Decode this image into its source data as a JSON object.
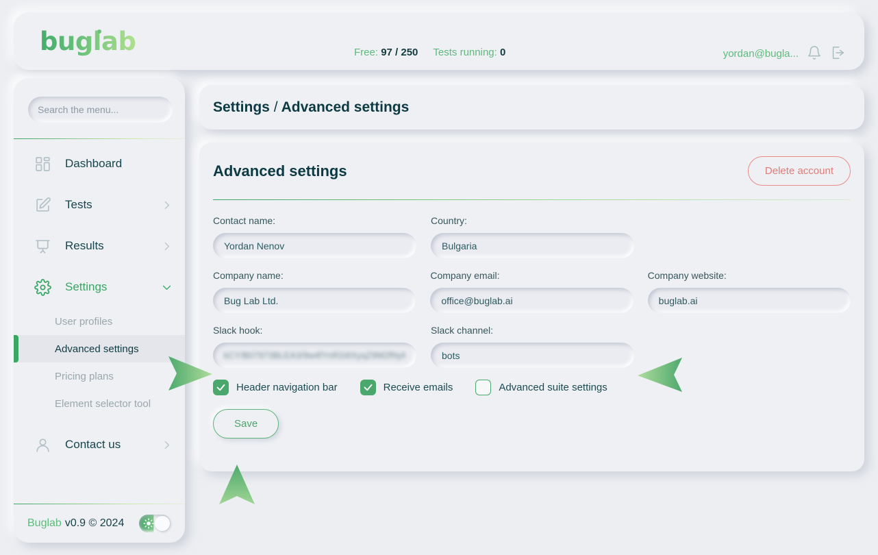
{
  "header": {
    "logo_text": "buglab",
    "free_label": "Free:",
    "free_value": "97 / 250",
    "tests_label": "Tests running:",
    "tests_value": "0",
    "user_email": "yordan@bugla...",
    "notification_icon": "bell-icon",
    "logout_icon": "logout-icon"
  },
  "sidebar": {
    "search": {
      "placeholder": "Search the menu...",
      "value": "",
      "clear_icon": "close-icon"
    },
    "items": [
      {
        "label": "Dashboard",
        "icon": "dashboard-grid-icon",
        "has_chevron": false,
        "expanded": false
      },
      {
        "label": "Tests",
        "icon": "edit-pencil-icon",
        "has_chevron": true,
        "expanded": false
      },
      {
        "label": "Results",
        "icon": "presentation-icon",
        "has_chevron": true,
        "expanded": false
      },
      {
        "label": "Settings",
        "icon": "gear-icon",
        "has_chevron": true,
        "expanded": true
      },
      {
        "label": "Contact us",
        "icon": "user-icon",
        "has_chevron": true,
        "expanded": false
      }
    ],
    "settings_submenu": [
      {
        "label": "User profiles",
        "active": false
      },
      {
        "label": "Advanced settings",
        "active": true
      },
      {
        "label": "Pricing plans",
        "active": false
      },
      {
        "label": "Element selector tool",
        "active": false
      }
    ],
    "footer": {
      "brand": "Buglab",
      "version": "v0.9 © 2024",
      "theme_toggle_icon": "sun-icon",
      "theme_toggle_on": true
    }
  },
  "breadcrumb": {
    "parent": "Settings",
    "separator": "/",
    "current": "Advanced settings"
  },
  "main": {
    "title": "Advanced settings",
    "delete_label": "Delete account",
    "save_label": "Save",
    "fields": [
      {
        "label": "Contact name:",
        "value": "Yordan Nenov",
        "redacted": false
      },
      {
        "label": "Country:",
        "value": "Bulgaria",
        "redacted": false
      },
      {
        "label": "Company name:",
        "value": "Bug Lab Ltd.",
        "redacted": false
      },
      {
        "label": "Company email:",
        "value": "office@buglab.ai",
        "redacted": false
      },
      {
        "label": "Company website:",
        "value": "buglab.ai",
        "redacted": false
      },
      {
        "label": "Slack hook:",
        "value": "kCY/B07973BLEA3/9w4fYnR2dIXyqZ9M2fNyM6C",
        "redacted": true
      },
      {
        "label": "Slack channel:",
        "value": "bots",
        "redacted": false
      }
    ],
    "checkboxes": [
      {
        "label": "Header navigation bar",
        "checked": true
      },
      {
        "label": "Receive emails",
        "checked": true
      },
      {
        "label": "Advanced suite settings",
        "checked": false
      }
    ]
  },
  "annotations": {
    "arrow_right": "arrow-right-pointer",
    "arrow_left": "arrow-left-pointer",
    "arrow_up": "arrow-up-pointer",
    "accent_green": "#3aa663",
    "accent_light_green": "#5dbb7c",
    "danger_red": "#e07c78",
    "text_dark": "#0d3a42",
    "background": "#eceef2"
  }
}
